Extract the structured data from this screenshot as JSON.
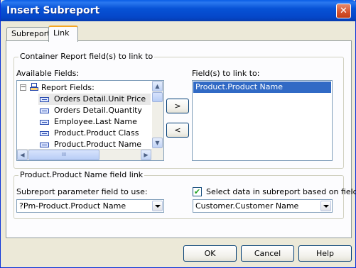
{
  "window": {
    "title": "Insert Subreport",
    "close_glyph": "✕"
  },
  "tabs": [
    {
      "label": "Subreport",
      "active": false
    },
    {
      "label": "Link",
      "active": true
    }
  ],
  "container_group": {
    "label": "Container Report field(s) to link to",
    "available_label": "Available Fields:",
    "linked_label": "Field(s) to link to:",
    "tree_root": "Report Fields:",
    "tree_root_toggle": "−",
    "available_fields": [
      "Orders Detail.Unit Price",
      "Orders Detail.Quantity",
      "Employee.Last Name",
      "Product.Product Class",
      "Product.Product Name"
    ],
    "linked_fields": [
      "Product.Product Name"
    ],
    "add_button": ">",
    "remove_button": "<",
    "scroll_left": "◀",
    "scroll_right": "▶",
    "scroll_up": "▲",
    "scroll_down": "▼",
    "scroll_thumb": "III"
  },
  "link_group": {
    "label": "Product.Product Name field link",
    "param_label": "Subreport parameter field to use:",
    "param_value": "?Pm-Product.Product Name",
    "checkbox_label": "Select data in subreport based on field:",
    "checkbox_checked": true,
    "checkbox_glyph": "✔",
    "field_value": "Customer.Customer Name"
  },
  "buttons": {
    "ok": "OK",
    "cancel": "Cancel",
    "help": "Help"
  }
}
